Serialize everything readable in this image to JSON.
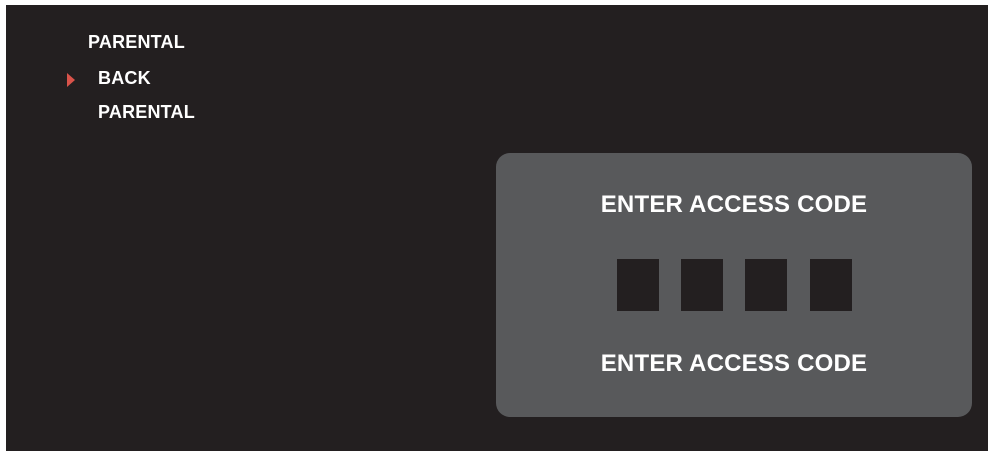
{
  "menu": {
    "header": "PARENTAL",
    "selector_icon": "triangle-right-icon",
    "selector_color": "#d9534a",
    "items": [
      {
        "label": "BACK",
        "selected": true
      },
      {
        "label": "PARENTAL",
        "selected": false
      }
    ]
  },
  "access_code_dialog": {
    "title": "ENTER ACCESS CODE",
    "instruction": "ENTER ACCESS CODE",
    "digits": [
      "",
      "",
      "",
      ""
    ]
  },
  "colors": {
    "background": "#231f20",
    "panel": "#58595b",
    "text": "#ffffff"
  }
}
